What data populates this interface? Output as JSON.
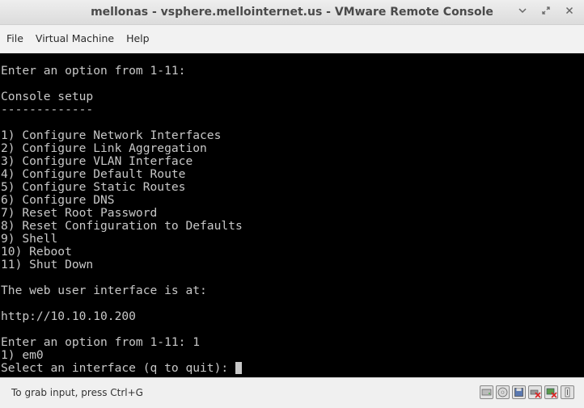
{
  "window": {
    "title": "mellonas - vsphere.mellointernet.us - VMware Remote Console",
    "minimize_glyph": "⌄",
    "restore_glyph": "⤡",
    "close_glyph": "✕"
  },
  "menubar": {
    "items": [
      {
        "label": "File"
      },
      {
        "label": "Virtual Machine"
      },
      {
        "label": "Help"
      }
    ]
  },
  "console": {
    "lines": [
      "Enter an option from 1-11:",
      "",
      "Console setup",
      "-------------",
      "",
      "1) Configure Network Interfaces",
      "2) Configure Link Aggregation",
      "3) Configure VLAN Interface",
      "4) Configure Default Route",
      "5) Configure Static Routes",
      "6) Configure DNS",
      "7) Reset Root Password",
      "8) Reset Configuration to Defaults",
      "9) Shell",
      "10) Reboot",
      "11) Shut Down",
      "",
      "The web user interface is at:",
      "",
      "http://10.10.10.200",
      "",
      "Enter an option from 1-11: 1",
      "1) em0"
    ],
    "prompt": "Select an interface (q to quit):"
  },
  "statusbar": {
    "hint": "To grab input, press Ctrl+G",
    "device_icons": [
      "hard-disk-icon",
      "cd-drive-icon",
      "floppy-icon",
      "usb-disconnected-icon",
      "network-disconnected-icon",
      "sound-icon"
    ]
  }
}
